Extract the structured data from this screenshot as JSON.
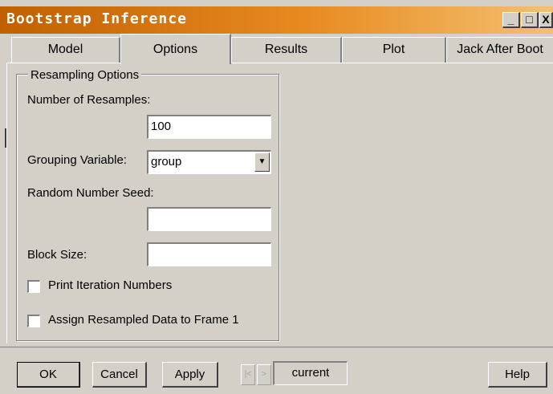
{
  "window": {
    "title": "Bootstrap Inference",
    "controls": {
      "minimize": "_",
      "maximize": "□",
      "close": "X"
    }
  },
  "tabs": [
    {
      "label": "Model",
      "active": false
    },
    {
      "label": "Options",
      "active": true
    },
    {
      "label": "Results",
      "active": false
    },
    {
      "label": "Plot",
      "active": false
    },
    {
      "label": "Jack After Boot",
      "active": false
    }
  ],
  "resampling": {
    "group_title": "Resampling Options",
    "num_resamples_label": "Number of Resamples:",
    "num_resamples_value": "100",
    "grouping_label": "Grouping Variable:",
    "grouping_value": "group",
    "seed_label": "Random Number Seed:",
    "seed_value": "",
    "block_size_label": "Block Size:",
    "block_size_value": "",
    "print_iter_label": "Print Iteration Numbers",
    "print_iter_checked": false,
    "assign_label": "Assign Resampled Data to Frame 1",
    "assign_checked": false
  },
  "footer": {
    "ok": "OK",
    "cancel": "Cancel",
    "apply": "Apply",
    "prev_icon": "|<",
    "next_icon": ">",
    "current": "current",
    "help": "Help"
  },
  "colors": {
    "titlebar_start": "#c06000",
    "titlebar_end": "#f4c070",
    "face": "#d4d0c8"
  }
}
